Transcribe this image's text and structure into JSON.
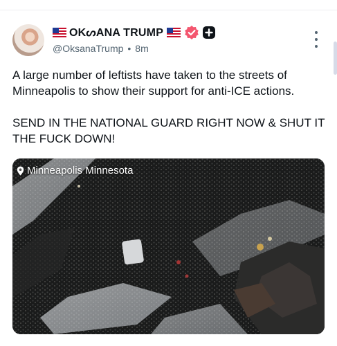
{
  "post": {
    "author": {
      "display_name": "OKᔕANA TRUMP",
      "handle": "@OksanaTrump",
      "time_ago": "8m",
      "flag_icon": "us-flag-icon",
      "verified_color": "#f4566f"
    },
    "text_paragraphs": [
      "A large number of leftists have taken to the streets of Minneapolis to show their support for anti-ICE actions.",
      "SEND IN THE NATIONAL GUARD RIGHT NOW & SHUT IT THE FUCK DOWN!"
    ],
    "media": {
      "location_label": "Minneapolis Minnesota"
    }
  },
  "ui": {
    "separator": "•"
  }
}
